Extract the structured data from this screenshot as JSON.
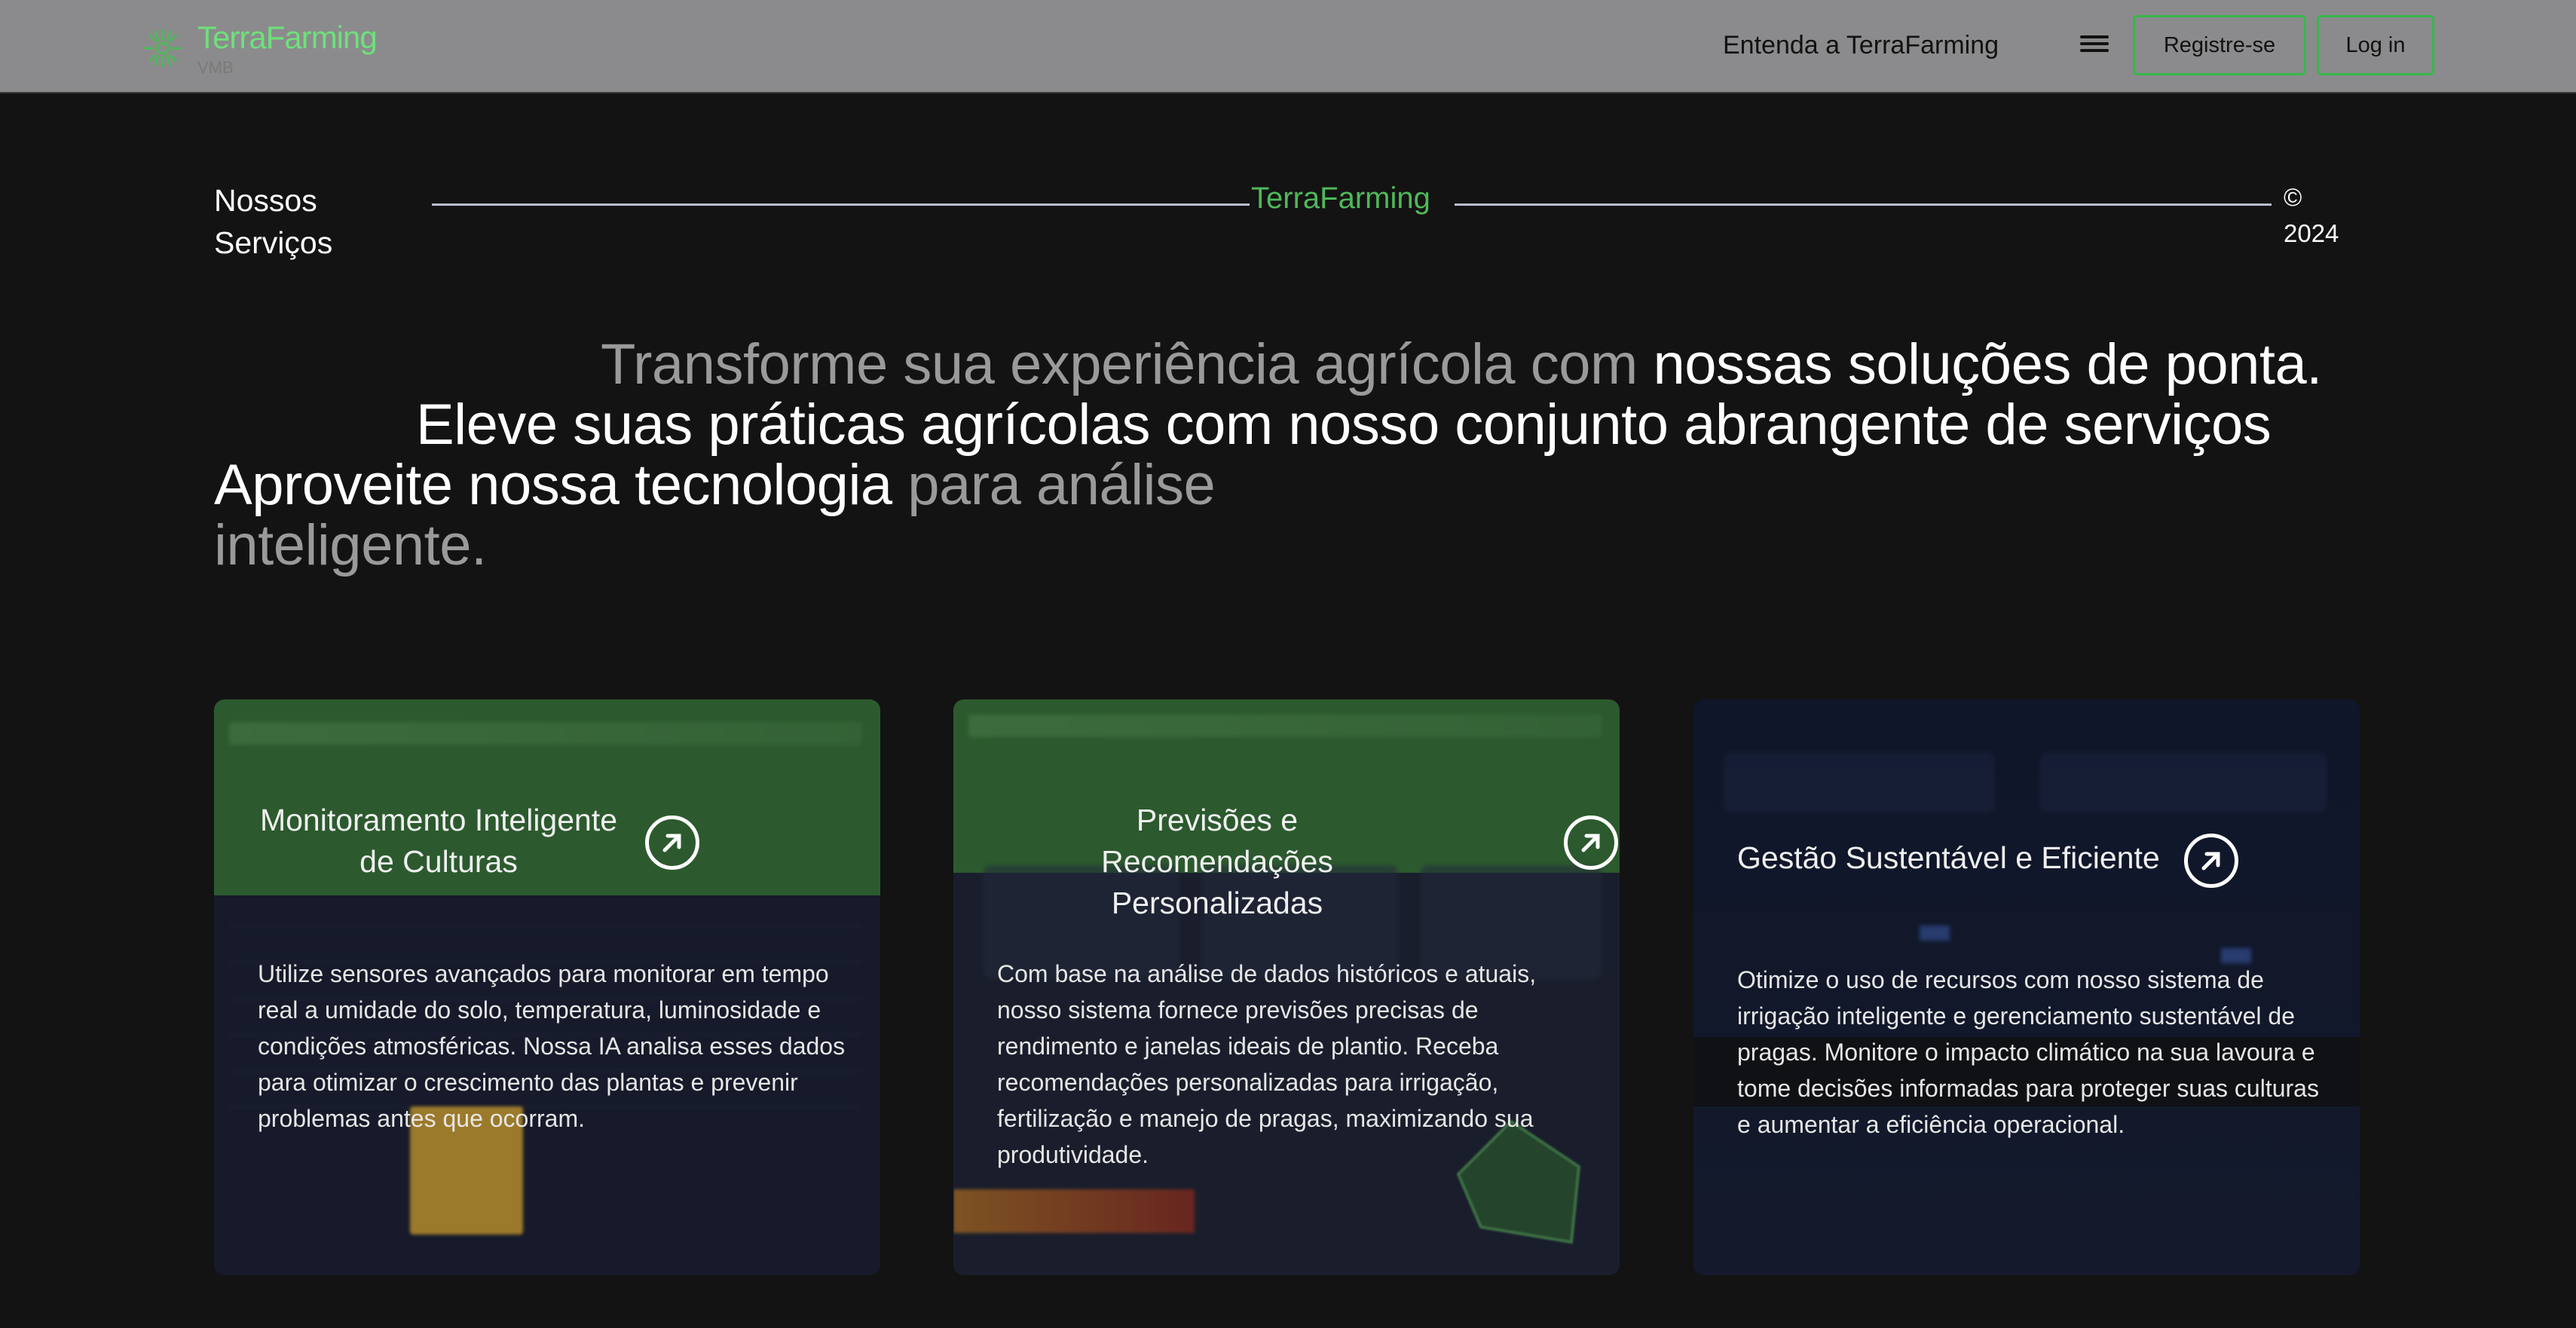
{
  "nav": {
    "brand_name": "TerraFarming",
    "brand_sub": "VMB",
    "link": "Entenda a TerraFarming",
    "register": "Registre-se",
    "login": "Log in",
    "accent": "#37b84a"
  },
  "section": {
    "label_line1": "Nossos",
    "label_line2": "Serviços",
    "center_brand": "TerraFarming",
    "copy_symbol": "©",
    "copy_year": "2024"
  },
  "headline": {
    "l1_dim": "Transforme sua experiência agrícola com ",
    "l1_bright": "nossas soluções de ponta.",
    "l2": "Eleve suas práticas agrícolas com nosso conjunto abrangente de serviços",
    "l3_bright": "Aproveite nossa tecnologia ",
    "l3_dim": "para análise",
    "l4_dim": "inteligente."
  },
  "cards": [
    {
      "title": "Monitoramento Inteligente de Culturas",
      "body": "Utilize sensores avançados para monitorar em tempo real a umidade do solo, temperatura, luminosidade e condições atmosféricas. Nossa IA analisa esses dados para otimizar o crescimento das plantas e prevenir problemas antes que ocorram.",
      "icon": "arrow-up-right-icon"
    },
    {
      "title": "Previsões e Recomendações Personalizadas",
      "body": "Com base na análise de dados históricos e atuais, nosso sistema fornece previsões precisas de rendimento e janelas ideais de plantio. Receba recomendações personalizadas para irrigação, fertilização e manejo de pragas, maximizando sua produtividade.",
      "icon": "arrow-up-right-icon"
    },
    {
      "title": "Gestão Sustentável e Eficiente",
      "body": "Otimize o uso de recursos com nosso sistema de irrigação inteligente e gerenciamento sustentável de pragas. Monitore o impacto climático na sua lavoura e tome decisões informadas para proteger suas culturas e aumentar a eficiência operacional.",
      "icon": "arrow-up-right-icon"
    }
  ]
}
